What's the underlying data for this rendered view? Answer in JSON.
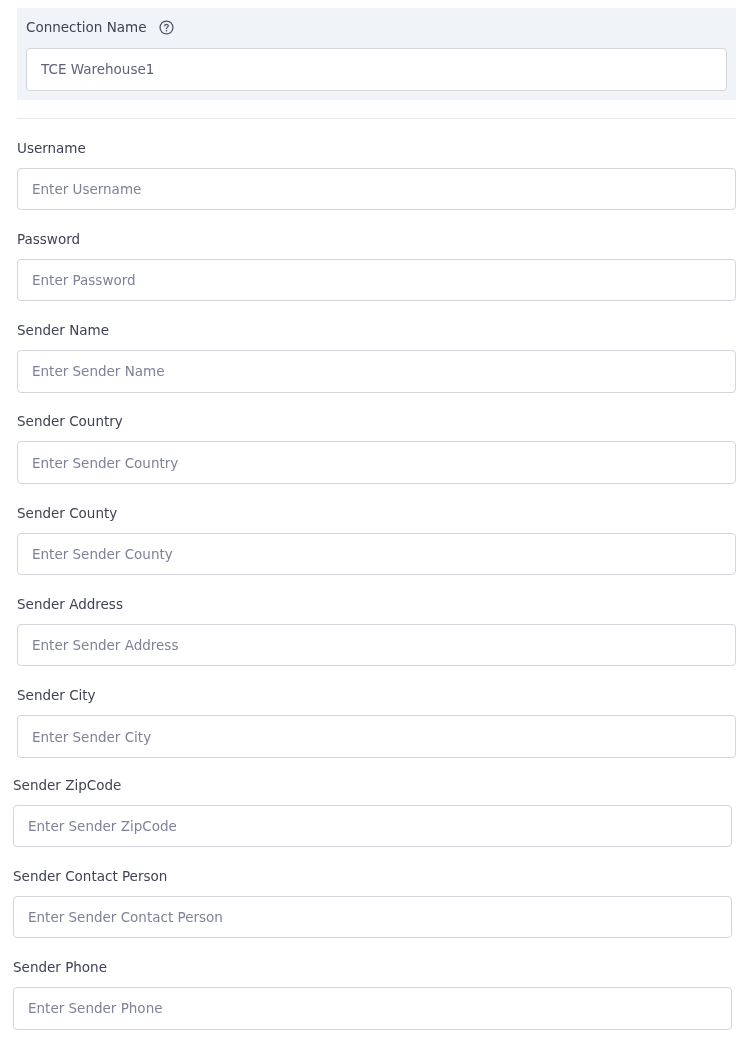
{
  "connection": {
    "label": "Connection Name",
    "value": "TCE Warehouse1"
  },
  "field_groups": [
    {
      "fields": [
        {
          "label": "Username",
          "placeholder": "Enter Username"
        },
        {
          "label": "Password",
          "placeholder": "Enter Password"
        },
        {
          "label": "Sender Name",
          "placeholder": "Enter Sender Name"
        },
        {
          "label": "Sender Country",
          "placeholder": "Enter Sender Country"
        },
        {
          "label": "Sender County",
          "placeholder": "Enter Sender County"
        },
        {
          "label": "Sender Address",
          "placeholder": "Enter Sender Address"
        },
        {
          "label": "Sender City",
          "placeholder": "Enter Sender City"
        }
      ]
    },
    {
      "fields": [
        {
          "label": "Sender ZipCode",
          "placeholder": "Enter Sender ZipCode"
        },
        {
          "label": "Sender Contact Person",
          "placeholder": "Enter Sender Contact Person"
        },
        {
          "label": "Sender Phone",
          "placeholder": "Enter Sender Phone"
        }
      ]
    }
  ]
}
